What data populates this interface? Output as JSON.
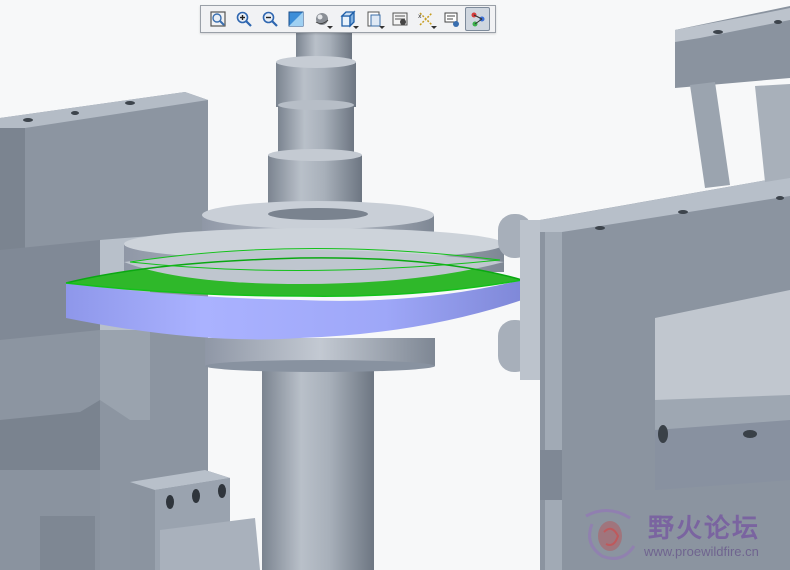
{
  "viewer": {
    "background": "#f7f8f9",
    "part_color": "#8d96a3",
    "highlight_surface_color": "#9aa4f6",
    "highlight_edge_color": "#13c11a"
  },
  "toolbar": {
    "buttons": [
      {
        "icon": "refit-icon",
        "label": "Refit"
      },
      {
        "icon": "zoom-in-icon",
        "label": "Zoom In"
      },
      {
        "icon": "zoom-out-icon",
        "label": "Zoom Out"
      },
      {
        "icon": "repaint-icon",
        "label": "Repaint"
      },
      {
        "icon": "display-style-icon",
        "label": "Display Style",
        "dropdown": true
      },
      {
        "icon": "saved-views-icon",
        "label": "Saved Orientations",
        "dropdown": true
      },
      {
        "icon": "view-manager-icon",
        "label": "View Manager",
        "dropdown": true
      },
      {
        "icon": "perspective-view-icon",
        "label": "Perspective View"
      },
      {
        "icon": "datum-display-icon",
        "label": "Datum Display Filters",
        "dropdown": true
      },
      {
        "icon": "annotation-display-icon",
        "label": "Annotation Display"
      },
      {
        "icon": "spin-center-icon",
        "label": "Spin Center",
        "active": true
      }
    ]
  },
  "watermark": {
    "title": "野火论坛",
    "url": "www.proewildfire.cn"
  }
}
